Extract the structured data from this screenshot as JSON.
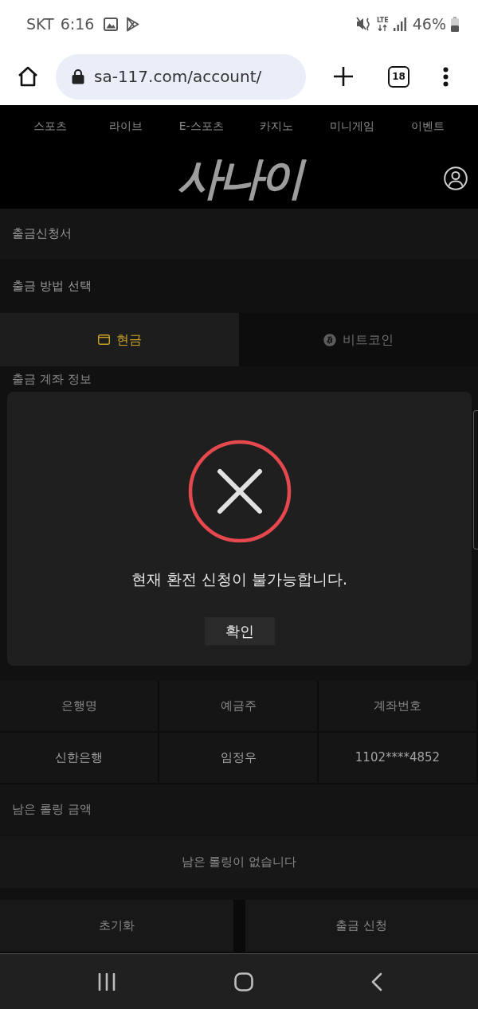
{
  "status_bar": {
    "carrier": "SKT",
    "time": "6:16",
    "network": "LTE",
    "battery": "46%"
  },
  "browser": {
    "url": "sa-117.com/account/",
    "tab_count": "18"
  },
  "nav": {
    "items": [
      "스포츠",
      "라이브",
      "E-스포츠",
      "카지노",
      "미니게임",
      "이벤트"
    ]
  },
  "header": {
    "logo": "사나이"
  },
  "form": {
    "title": "출금신청서",
    "method_label": "출금 방법 선택",
    "methods": [
      {
        "kind": "cash",
        "label": "현금",
        "selected": true
      },
      {
        "kind": "bitcoin",
        "label": "비트코인",
        "selected": false
      }
    ],
    "account_label": "출금 계좌 정보",
    "account_table": {
      "columns": [
        "은행명",
        "예금주",
        "계좌번호"
      ],
      "rows": [
        [
          "신한은행",
          "임정우",
          "1102****4852"
        ]
      ]
    },
    "rolling_label": "남은 롤링 금액",
    "rolling_message": "남은 롤링이 없습니다",
    "buttons": [
      "초기화",
      "출금 신청"
    ]
  },
  "dialog": {
    "kind": "error",
    "message": "현재 환전 신청이 불가능합니다.",
    "button": "확인"
  }
}
